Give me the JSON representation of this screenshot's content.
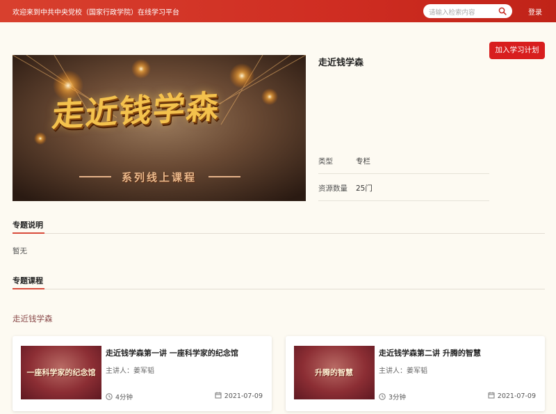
{
  "header": {
    "welcome": "欢迎来到中共中央党校（国家行政学院）在线学习平台",
    "search_placeholder": "请输入检索内容",
    "login": "登录"
  },
  "banner": {
    "title": "走近钱学森",
    "subtitle": "系列线上课程"
  },
  "course": {
    "title": "走近钱学森",
    "join_button": "加入学习计划",
    "info": [
      {
        "key": "类型",
        "value": "专栏"
      },
      {
        "key": "资源数量",
        "value": "25门"
      }
    ]
  },
  "sections": {
    "description_title": "专题说明",
    "description_text": "暂无",
    "courses_title": "专题课程",
    "group_label": "走近钱学森"
  },
  "cards": [
    {
      "thumb_text": "一座科学家的纪念馆",
      "title": "走近钱学森第一讲 一座科学家的纪念馆",
      "lecturer": "主讲人：姜军韬",
      "duration": "4分钟",
      "date": "2021-07-09"
    },
    {
      "thumb_text": "升腾的智慧",
      "title": "走近钱学森第二讲 升腾的智慧",
      "lecturer": "主讲人：姜军韬",
      "duration": "3分钟",
      "date": "2021-07-09"
    }
  ],
  "colors": {
    "header": "#cf2d22",
    "accent_button": "#d81e1e",
    "page_bg": "#fdfaf2",
    "section_underline": "#d84a3a"
  }
}
